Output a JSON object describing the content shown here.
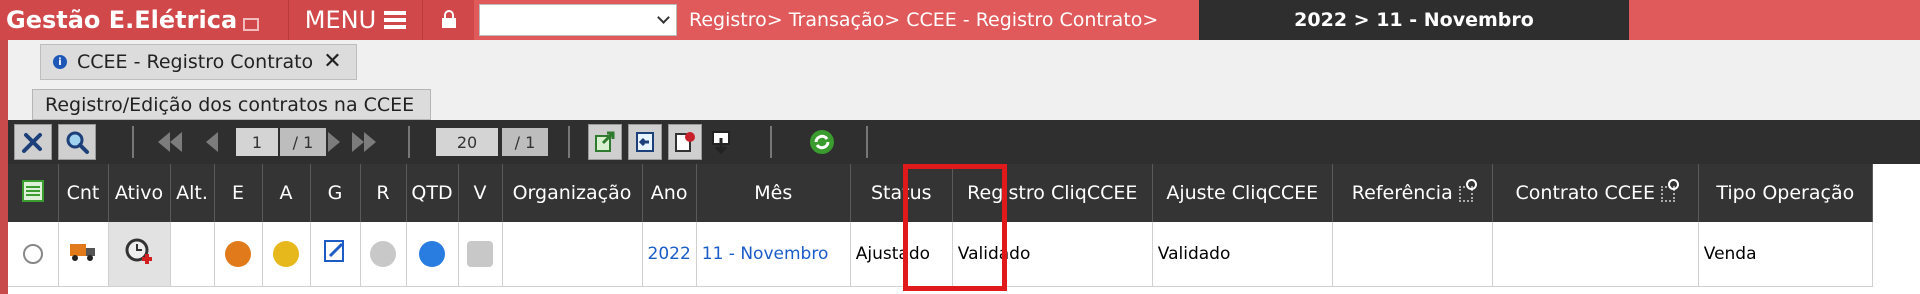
{
  "topbar": {
    "app_title": "Gestão E.Elétrica",
    "menu_label": "MENU",
    "select_value": "",
    "breadcrumb": "Registro> Transação> CCEE - Registro Contrato>",
    "period": "2022 > 11 - Novembro"
  },
  "tab": {
    "label": "CCEE - Registro Contrato",
    "close": "✕",
    "info": "i"
  },
  "subtitle": "Registro/Edição dos contratos na CCEE",
  "toolbar": {
    "page_current": "1",
    "page_total": "/ 1",
    "page_size": "20",
    "page_size_total": "/ 1",
    "icons": [
      "tools-icon",
      "search-icon",
      "first-page-icon",
      "prev-page-icon",
      "next-page-icon",
      "last-page-icon",
      "export-icon",
      "import-icon",
      "report-icon",
      "download-icon",
      "refresh-icon"
    ]
  },
  "grid": {
    "columns": [
      "",
      "Cnt",
      "Ativo",
      "Alt.",
      "E",
      "A",
      "G",
      "R",
      "QTD",
      "V",
      "Organização",
      "Ano",
      "Mês",
      "Status",
      "Registro CliqCCEE",
      "Ajuste CliqCCEE",
      "Referência",
      "Contrato CCEE",
      "Tipo Operação"
    ],
    "rows": [
      {
        "ano": "2022",
        "mes": "11 - Novembro",
        "status": "Ajustado",
        "registro": "Validado",
        "ajuste": "Validado",
        "referencia": "",
        "contrato": "",
        "tipo": "Venda",
        "organizacao": ""
      }
    ]
  },
  "colors": {
    "topbar": "#e0595b",
    "header": "#343434",
    "link": "#1a5cc8",
    "highlight": "#e01a1a"
  }
}
